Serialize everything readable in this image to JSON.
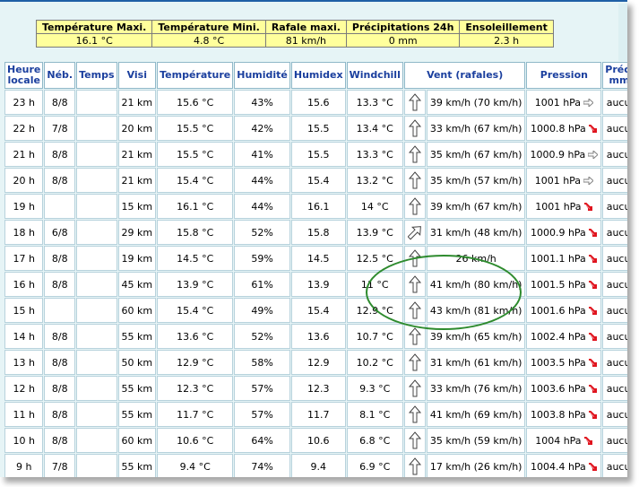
{
  "summary": {
    "headers": [
      "Température Maxi.",
      "Température Mini.",
      "Rafale maxi.",
      "Précipitations 24h",
      "Ensoleillement"
    ],
    "values": [
      "16.1 °C",
      "4.8 °C",
      "81 km/h",
      "0 mm",
      "2.3 h"
    ]
  },
  "table": {
    "headers": [
      "Heure locale",
      "Néb.",
      "Temps",
      "Visi",
      "Température",
      "Humidité",
      "Humidex",
      "Windchill",
      "Vent (rafales)",
      "Pression",
      "Précip. mm/h"
    ],
    "rows": [
      {
        "heure": "23 h",
        "neb": "8/8",
        "temps": "",
        "visi": "21 km",
        "temp": "15.6 °C",
        "hum": "43%",
        "humidex": "15.6",
        "windchill": "13.3 °C",
        "arrow": "up",
        "vent": "39 km/h (70 km/h)",
        "pression": "1001 hPa",
        "trend": "right",
        "precip": "aucune"
      },
      {
        "heure": "22 h",
        "neb": "7/8",
        "temps": "",
        "visi": "20 km",
        "temp": "15.5 °C",
        "hum": "42%",
        "humidex": "15.5",
        "windchill": "13.4 °C",
        "arrow": "up",
        "vent": "33 km/h (67 km/h)",
        "pression": "1000.8 hPa",
        "trend": "down",
        "precip": "aucune"
      },
      {
        "heure": "21 h",
        "neb": "8/8",
        "temps": "",
        "visi": "21 km",
        "temp": "15.5 °C",
        "hum": "41%",
        "humidex": "15.5",
        "windchill": "13.3 °C",
        "arrow": "up",
        "vent": "35 km/h (67 km/h)",
        "pression": "1000.9 hPa",
        "trend": "right",
        "precip": "aucune"
      },
      {
        "heure": "20 h",
        "neb": "8/8",
        "temps": "",
        "visi": "21 km",
        "temp": "15.4 °C",
        "hum": "44%",
        "humidex": "15.4",
        "windchill": "13.2 °C",
        "arrow": "up",
        "vent": "35 km/h (57 km/h)",
        "pression": "1001 hPa",
        "trend": "right",
        "precip": "aucune"
      },
      {
        "heure": "19 h",
        "neb": "",
        "temps": "",
        "visi": "15 km",
        "temp": "16.1 °C",
        "hum": "44%",
        "humidex": "16.1",
        "windchill": "14 °C",
        "arrow": "up",
        "vent": "39 km/h (67 km/h)",
        "pression": "1001 hPa",
        "trend": "down",
        "precip": "aucune"
      },
      {
        "heure": "18 h",
        "neb": "6/8",
        "temps": "",
        "visi": "29 km",
        "temp": "15.8 °C",
        "hum": "52%",
        "humidex": "15.8",
        "windchill": "13.9 °C",
        "arrow": "upright",
        "vent": "31 km/h (48 km/h)",
        "pression": "1000.9 hPa",
        "trend": "down",
        "precip": "aucune"
      },
      {
        "heure": "17 h",
        "neb": "8/8",
        "temps": "",
        "visi": "19 km",
        "temp": "14.5 °C",
        "hum": "59%",
        "humidex": "14.5",
        "windchill": "12.5 °C",
        "arrow": "up",
        "vent": "26 km/h",
        "pression": "1001.1 hPa",
        "trend": "down",
        "precip": "aucune"
      },
      {
        "heure": "16 h",
        "neb": "8/8",
        "temps": "",
        "visi": "45 km",
        "temp": "13.9 °C",
        "hum": "61%",
        "humidex": "13.9",
        "windchill": "11 °C",
        "arrow": "up",
        "vent": "41 km/h (80 km/h)",
        "pression": "1001.5 hPa",
        "trend": "down",
        "precip": "aucune"
      },
      {
        "heure": "15 h",
        "neb": "",
        "temps": "",
        "visi": "60 km",
        "temp": "15.4 °C",
        "hum": "49%",
        "humidex": "15.4",
        "windchill": "12.9 °C",
        "arrow": "up",
        "vent": "43 km/h (81 km/h)",
        "pression": "1001.6 hPa",
        "trend": "down",
        "precip": "aucune"
      },
      {
        "heure": "14 h",
        "neb": "8/8",
        "temps": "",
        "visi": "55 km",
        "temp": "13.6 °C",
        "hum": "52%",
        "humidex": "13.6",
        "windchill": "10.7 °C",
        "arrow": "up",
        "vent": "39 km/h (65 km/h)",
        "pression": "1002.4 hPa",
        "trend": "down",
        "precip": "aucune"
      },
      {
        "heure": "13 h",
        "neb": "8/8",
        "temps": "",
        "visi": "50 km",
        "temp": "12.9 °C",
        "hum": "58%",
        "humidex": "12.9",
        "windchill": "10.2 °C",
        "arrow": "up",
        "vent": "31 km/h (61 km/h)",
        "pression": "1003.5 hPa",
        "trend": "down",
        "precip": "aucune"
      },
      {
        "heure": "12 h",
        "neb": "8/8",
        "temps": "",
        "visi": "55 km",
        "temp": "12.3 °C",
        "hum": "57%",
        "humidex": "12.3",
        "windchill": "9.3 °C",
        "arrow": "up",
        "vent": "33 km/h (76 km/h)",
        "pression": "1003.6 hPa",
        "trend": "down",
        "precip": "aucune"
      },
      {
        "heure": "11 h",
        "neb": "8/8",
        "temps": "",
        "visi": "55 km",
        "temp": "11.7 °C",
        "hum": "57%",
        "humidex": "11.7",
        "windchill": "8.1 °C",
        "arrow": "up",
        "vent": "41 km/h (69 km/h)",
        "pression": "1003.8 hPa",
        "trend": "down",
        "precip": "aucune"
      },
      {
        "heure": "10 h",
        "neb": "8/8",
        "temps": "",
        "visi": "60 km",
        "temp": "10.6 °C",
        "hum": "64%",
        "humidex": "10.6",
        "windchill": "6.8 °C",
        "arrow": "up",
        "vent": "35 km/h (59 km/h)",
        "pression": "1004 hPa",
        "trend": "down",
        "precip": "aucune"
      },
      {
        "heure": "9 h",
        "neb": "7/8",
        "temps": "",
        "visi": "55 km",
        "temp": "9.4 °C",
        "hum": "74%",
        "humidex": "9.4",
        "windchill": "6.9 °C",
        "arrow": "up",
        "vent": "17 km/h (26 km/h)",
        "pression": "1004.4 hPa",
        "trend": "down",
        "precip": "aucune"
      }
    ]
  },
  "colors": {
    "header_text": "#1b3f9e",
    "summary_bg": "#ffff9c",
    "trend_down": "#e0141e",
    "trend_right": "#7f7f7f",
    "annotation_oval": "#2e8b2e"
  },
  "icons": {
    "wind_direction": "wind-arrow-icon",
    "pressure_trend": "pressure-trend-icon"
  }
}
